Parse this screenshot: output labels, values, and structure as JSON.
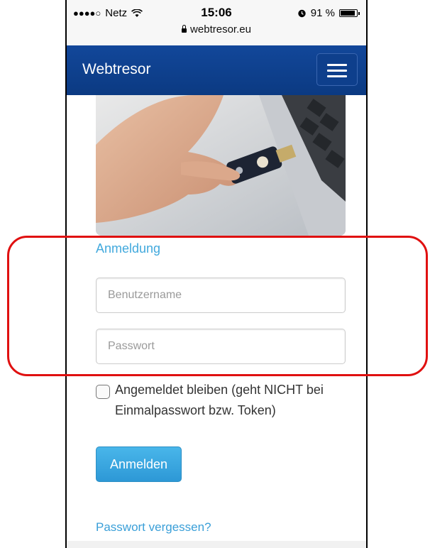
{
  "status_bar": {
    "signal": "●●●●○",
    "carrier": "Netz",
    "time": "15:06",
    "battery_percent": "91 %",
    "battery_level": 0.91,
    "url": "webtresor.eu"
  },
  "navbar": {
    "brand": "Webtresor"
  },
  "login": {
    "heading": "Anmeldung",
    "username_placeholder": "Benutzername",
    "password_placeholder": "Passwort",
    "remember_label": "Angemeldet bleiben (geht NICHT bei Einmalpasswort bzw. Token)",
    "submit_label": "Anmelden",
    "forgot_link": "Passwort vergessen?"
  },
  "colors": {
    "navbar": "#0d3f8c",
    "link": "#42a9dd",
    "button": "#3aa7e0",
    "highlight": "#e01010"
  }
}
